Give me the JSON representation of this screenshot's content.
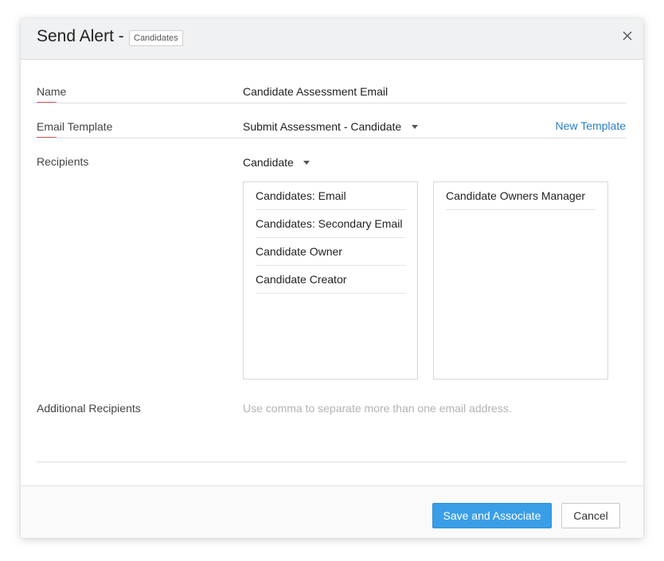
{
  "dialog": {
    "title": "Send Alert -",
    "module_badge": "Candidates",
    "close_icon": "close-icon"
  },
  "form": {
    "name": {
      "label": "Name",
      "value": "Candidate Assessment Email"
    },
    "email_template": {
      "label": "Email Template",
      "value": "Submit Assessment - Candidate",
      "link": "New Template"
    },
    "recipients": {
      "label": "Recipients",
      "selected_module": "Candidate",
      "available": [
        "Candidates: Email",
        "Candidates: Secondary Email",
        "Candidate Owner",
        "Candidate Creator"
      ],
      "selected": [
        "Candidate Owners Manager"
      ]
    },
    "additional_recipients": {
      "label": "Additional Recipients",
      "placeholder": "Use comma to separate more than one email address."
    }
  },
  "footer": {
    "primary_label": "Save and Associate",
    "cancel_label": "Cancel"
  },
  "colors": {
    "accent": "#3a9ee6",
    "link": "#2a7fc8",
    "required_underline": "#e65c5c"
  }
}
